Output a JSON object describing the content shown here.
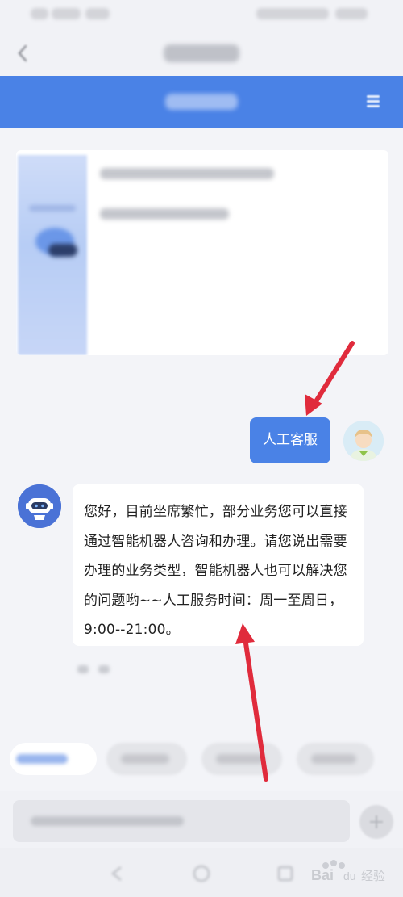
{
  "user_message": {
    "text": "人工客服"
  },
  "bot_message": {
    "text": "您好，目前坐席繁忙，部分业务您可以直接通过智能机器人咨询和办理。请您说出需要办理的业务类型，智能机器人也可以解决您的问题哟~~人工服务时间：周一至周日，9:00--21:00。"
  },
  "watermark": {
    "text": "Baidu经验"
  },
  "colors": {
    "accent_blue": "#4a82e6",
    "annotation_red": "#e02b3c",
    "background": "#f3f4f8"
  },
  "icons": {
    "nav": "back-icon",
    "banner": "menu-icon",
    "input": "plus-icon"
  }
}
